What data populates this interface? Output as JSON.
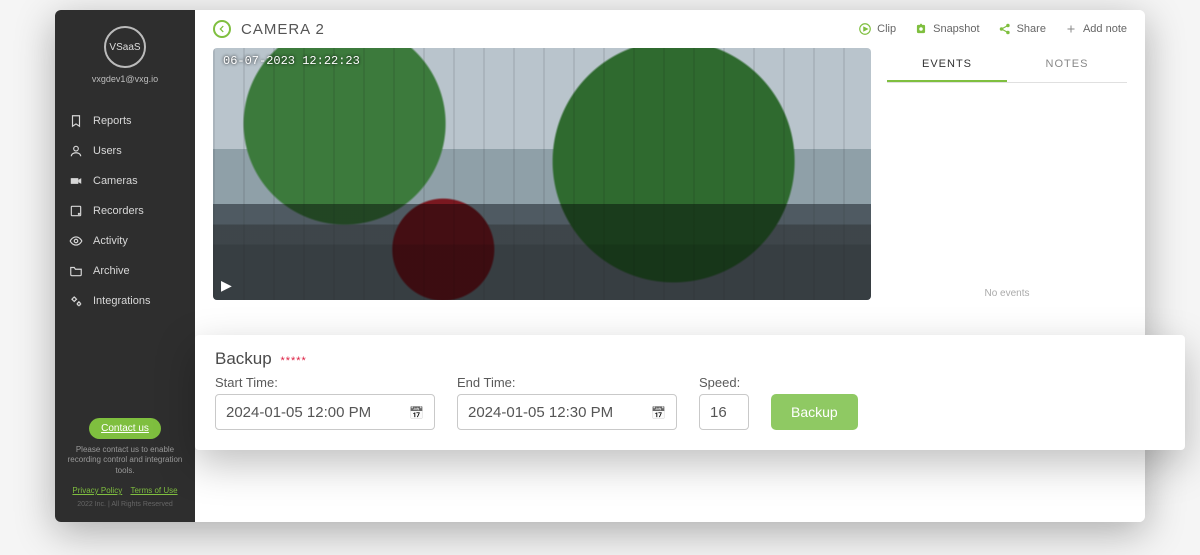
{
  "brand": {
    "name": "VSaaS",
    "email": "vxgdev1@vxg.io"
  },
  "sidebar": {
    "items": [
      {
        "label": "Reports",
        "icon": "bookmark-icon"
      },
      {
        "label": "Users",
        "icon": "user-icon"
      },
      {
        "label": "Cameras",
        "icon": "camera-icon"
      },
      {
        "label": "Recorders",
        "icon": "recorder-icon"
      },
      {
        "label": "Activity",
        "icon": "eye-icon"
      },
      {
        "label": "Archive",
        "icon": "folder-icon"
      },
      {
        "label": "Integrations",
        "icon": "gears-icon"
      }
    ],
    "contact_label": "Contact us",
    "contact_text": "Please contact us to enable recording control and integration tools.",
    "privacy": "Privacy Policy",
    "terms": "Terms of Use",
    "copyright": "2022 Inc. | All Rights Reserved"
  },
  "header": {
    "title": "CAMERA 2",
    "actions": {
      "clip": "Clip",
      "snapshot": "Snapshot",
      "share": "Share",
      "addnote": "Add note"
    }
  },
  "video": {
    "timestamp": "06-07-2023 12:22:23"
  },
  "tabs": {
    "events": "EVENTS",
    "notes": "NOTES",
    "empty": "No events"
  },
  "backup_popup": {
    "title": "Backup",
    "asterisks": "*****",
    "start_label": "Start Time:",
    "start_value": "2024-01-05 12:00  PM",
    "end_label": "End Time:",
    "end_value": "2024-01-05 12:30  PM",
    "speed_label": "Speed:",
    "speed_value": "16",
    "button": "Backup"
  },
  "backup_small": {
    "title": "Backup",
    "asterisks": "*****",
    "start_label": "Start Time:",
    "start_value": "2024-01-05 12:00  PM",
    "end_label": "End Time:",
    "end_value": "2024-01-05 12:30  PM",
    "speed_label": "Speed:",
    "speed_value": "16",
    "button": "Backup"
  }
}
